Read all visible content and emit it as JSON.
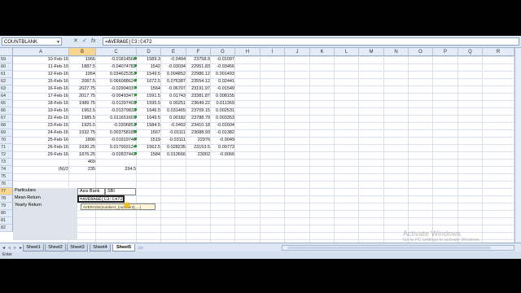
{
  "formula_bar": {
    "name_box": "COUNTBLANK",
    "cancel": "✕",
    "enter": "✓",
    "fx": "fx",
    "formula": "=AVERAGE(C3:C472"
  },
  "columns": [
    "A",
    "B",
    "C",
    "D",
    "E",
    "F",
    "G",
    "H",
    "I",
    "J",
    "K",
    "L",
    "M",
    "N",
    "O",
    "P",
    "Q",
    "R"
  ],
  "rows": [
    {
      "n": "59",
      "date": "10-Feb-16",
      "b": "1966",
      "c": "-0.01814566",
      "d": "1589.3",
      "e": "-0.0494",
      "f": "23758.9",
      "g": "-0.01097"
    },
    {
      "n": "60",
      "date": "11-Feb-16",
      "b": "1887.5",
      "c": "-0.04074782",
      "d": "1542",
      "e": "-0.03034",
      "f": "22951.83",
      "g": "-0.03456"
    },
    {
      "n": "61",
      "date": "12-Feb-16",
      "b": "1954",
      "c": "0.034625351",
      "d": "1549.5",
      "e": "0.004852",
      "f": "22986.12",
      "g": "0.001493"
    },
    {
      "n": "62",
      "date": "15-Feb-16",
      "b": "2087.5",
      "c": "0.066088624",
      "d": "1672.5",
      "e": "0.076387",
      "f": "23554.12",
      "g": "0.02441"
    },
    {
      "n": "63",
      "date": "16-Feb-16",
      "b": "2027.75",
      "c": "-0.02904037",
      "d": "1564",
      "e": "-0.06707",
      "f": "23191.97",
      "g": "-0.01549"
    },
    {
      "n": "64",
      "date": "17-Feb-16",
      "b": "2017.75",
      "c": "-0.00493477",
      "d": "1591.5",
      "e": "0.01743",
      "f": "23381.87",
      "g": "0.008155"
    },
    {
      "n": "65",
      "date": "18-Feb-16",
      "b": "1989.75",
      "c": "-0.01397403",
      "d": "1595.5",
      "e": "0.00251",
      "f": "23649.22",
      "g": "0.011369"
    },
    {
      "n": "66",
      "date": "19-Feb-16",
      "b": "1962.5",
      "c": "-0.01379833",
      "d": "1646.5",
      "e": "0.031465",
      "f": "23709.15",
      "g": "0.002531"
    },
    {
      "n": "67",
      "date": "22-Feb-16",
      "b": "1985.5",
      "c": "0.011651601",
      "d": "1649.5",
      "e": "0.00182",
      "f": "23788.79",
      "g": "0.003353"
    },
    {
      "n": "68",
      "date": "23-Feb-16",
      "b": "1925.5",
      "c": "-0.0306851",
      "d": "1584.5",
      "e": "-0.0402",
      "f": "23410.18",
      "g": "-0.01604"
    },
    {
      "n": "69",
      "date": "24-Feb-16",
      "b": "1932.75",
      "c": "0.003758185",
      "d": "1567",
      "e": "-0.01111",
      "f": "23088.93",
      "g": "-0.01382"
    },
    {
      "n": "70",
      "date": "25-Feb-16",
      "b": "1896",
      "c": "-0.01919746",
      "d": "1519",
      "e": "-0.03111",
      "f": "22976",
      "g": "-0.0049"
    },
    {
      "n": "71",
      "date": "26-Feb-16",
      "b": "1930.25",
      "c": "0.017903124",
      "d": "1562.5",
      "e": "0.028235",
      "f": "23153.5",
      "g": "0.00773"
    },
    {
      "n": "72",
      "date": "29-Feb-16",
      "b": "1876.25",
      "c": "-0.02837442",
      "d": "1584",
      "e": "0.013666",
      "f": "23002",
      "g": "-0.0066"
    },
    {
      "n": "73",
      "date": "",
      "b": "469",
      "c": "",
      "d": "",
      "e": "",
      "f": "",
      "g": ""
    },
    {
      "n": "74",
      "date": "(N)/2",
      "b": "235",
      "c": "234.5",
      "d": "",
      "e": "",
      "f": "",
      "g": ""
    },
    {
      "n": "75",
      "date": "",
      "b": "",
      "c": "",
      "d": "",
      "e": "",
      "f": "",
      "g": ""
    }
  ],
  "summary_table": {
    "particulars_label": "Particulars",
    "axis_bank_label": "Axis Bank",
    "sbi_label": "SBI",
    "mean_return_label": "Mean Return",
    "yearly_return_label": "Yearly Return",
    "editing_formula": "=AVERAGE(C3:C472",
    "tooltip": "AVERAGE(number1, [number2], ...)"
  },
  "lower_row_numbers": [
    "76",
    "77",
    "78",
    "79",
    "80",
    "81",
    "82"
  ],
  "sheet_tabs": [
    "Sheet1",
    "Sheet2",
    "Sheet3",
    "Sheet4",
    "Sheet5"
  ],
  "active_sheet": "Sheet5",
  "status": "Enter",
  "watermark": {
    "title": "Activate Windows",
    "subtitle": "Go to PC settings to activate Windows."
  }
}
